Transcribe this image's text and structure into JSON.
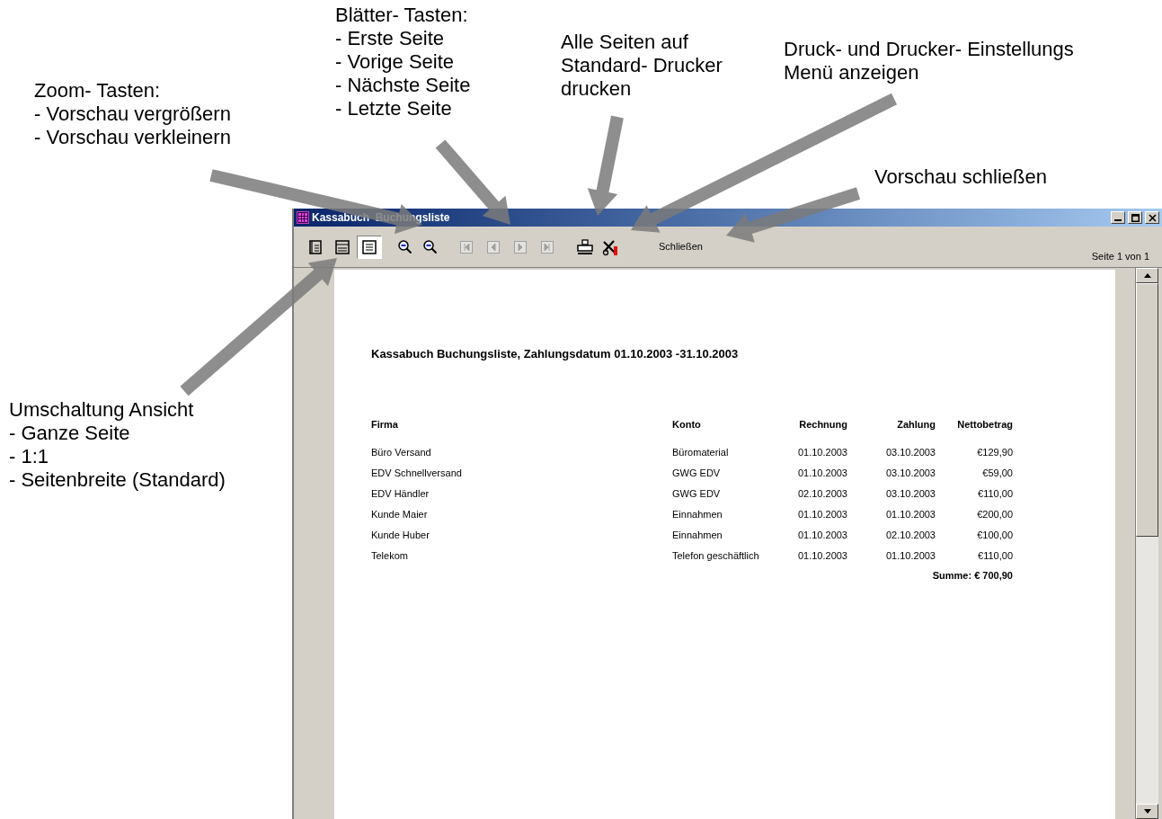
{
  "annotations": [
    {
      "lines": [
        "Zoom- Tasten:",
        "- Vorschau vergrößern",
        "- Vorschau verkleinern"
      ]
    },
    {
      "lines": [
        "Blätter- Tasten:",
        "- Erste Seite",
        "- Vorige Seite",
        "- Nächste Seite",
        "- Letzte Seite"
      ]
    },
    {
      "lines": [
        "Alle Seiten auf",
        "Standard- Drucker",
        "drucken"
      ]
    },
    {
      "lines": [
        "Druck- und Drucker- Einstellungs",
        "Menü anzeigen"
      ]
    },
    {
      "lines": [
        "Vorschau schließen"
      ]
    },
    {
      "lines": [
        "Umschaltung Ansicht",
        "- Ganze Seite",
        "- 1:1",
        "- Seitenbreite (Standard)"
      ]
    }
  ],
  "window": {
    "title": "Kassabuch  Buchungsliste",
    "toolbar": {
      "view_buttons": [
        {
          "selected": false
        },
        {
          "selected": false
        },
        {
          "selected": true
        }
      ],
      "nav_buttons": [
        {
          "disabled": true
        },
        {
          "disabled": true
        },
        {
          "disabled": true
        },
        {
          "disabled": true
        }
      ],
      "close_button": "Schließen",
      "page_indicator": "Seite 1 von 1"
    }
  },
  "report": {
    "title": "Kassabuch Buchungsliste, Zahlungsdatum 01.10.2003 -31.10.2003",
    "columns": [
      "Firma",
      "Konto",
      "Rechnung",
      "Zahlung",
      "Nettobetrag"
    ],
    "rows": [
      [
        "Büro Versand",
        "Büromaterial",
        "01.10.2003",
        "03.10.2003",
        "€129,90"
      ],
      [
        "EDV Schnellversand",
        "GWG EDV",
        "01.10.2003",
        "03.10.2003",
        "€59,00"
      ],
      [
        "EDV Händler",
        "GWG EDV",
        "02.10.2003",
        "03.10.2003",
        "€110,00"
      ],
      [
        "Kunde Maier",
        "Einnahmen",
        "01.10.2003",
        "01.10.2003",
        "€200,00"
      ],
      [
        "Kunde Huber",
        "Einnahmen",
        "01.10.2003",
        "02.10.2003",
        "€100,00"
      ],
      [
        "Telekom",
        "Telefon geschäftlich",
        "01.10.2003",
        "01.10.2003",
        "€110,00"
      ]
    ],
    "total": "Summe: € 700,90"
  }
}
